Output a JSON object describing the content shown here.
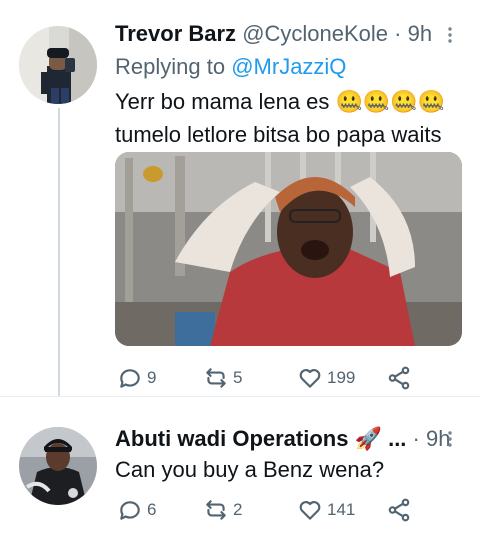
{
  "tweets": [
    {
      "display_name": "Trevor Barz",
      "handle": "@CycloneKole",
      "separator": "·",
      "time": "9h",
      "replying_prefix": "Replying to",
      "replying_to": "@MrJazziQ",
      "text_line1": "Yerr bo mama lena es 🤐🤐🤐🤐",
      "text_line2": "tumelo letlore bitsa bo papa waits",
      "replies": "9",
      "retweets": "5",
      "likes": "199"
    },
    {
      "display_name": "Abuti wadi Operations 🚀 ...",
      "separator": "·",
      "time": "9h",
      "text_line1": "Can you buy a Benz wena?",
      "replies": "6",
      "retweets": "2",
      "likes": "141"
    }
  ],
  "icons": {
    "more": "more-vertical-icon",
    "reply": "reply-icon",
    "retweet": "retweet-icon",
    "like": "heart-icon",
    "share": "share-icon"
  },
  "colors": {
    "link": "#1d9bf0",
    "muted": "#536471",
    "divider": "#e6ecf0"
  }
}
